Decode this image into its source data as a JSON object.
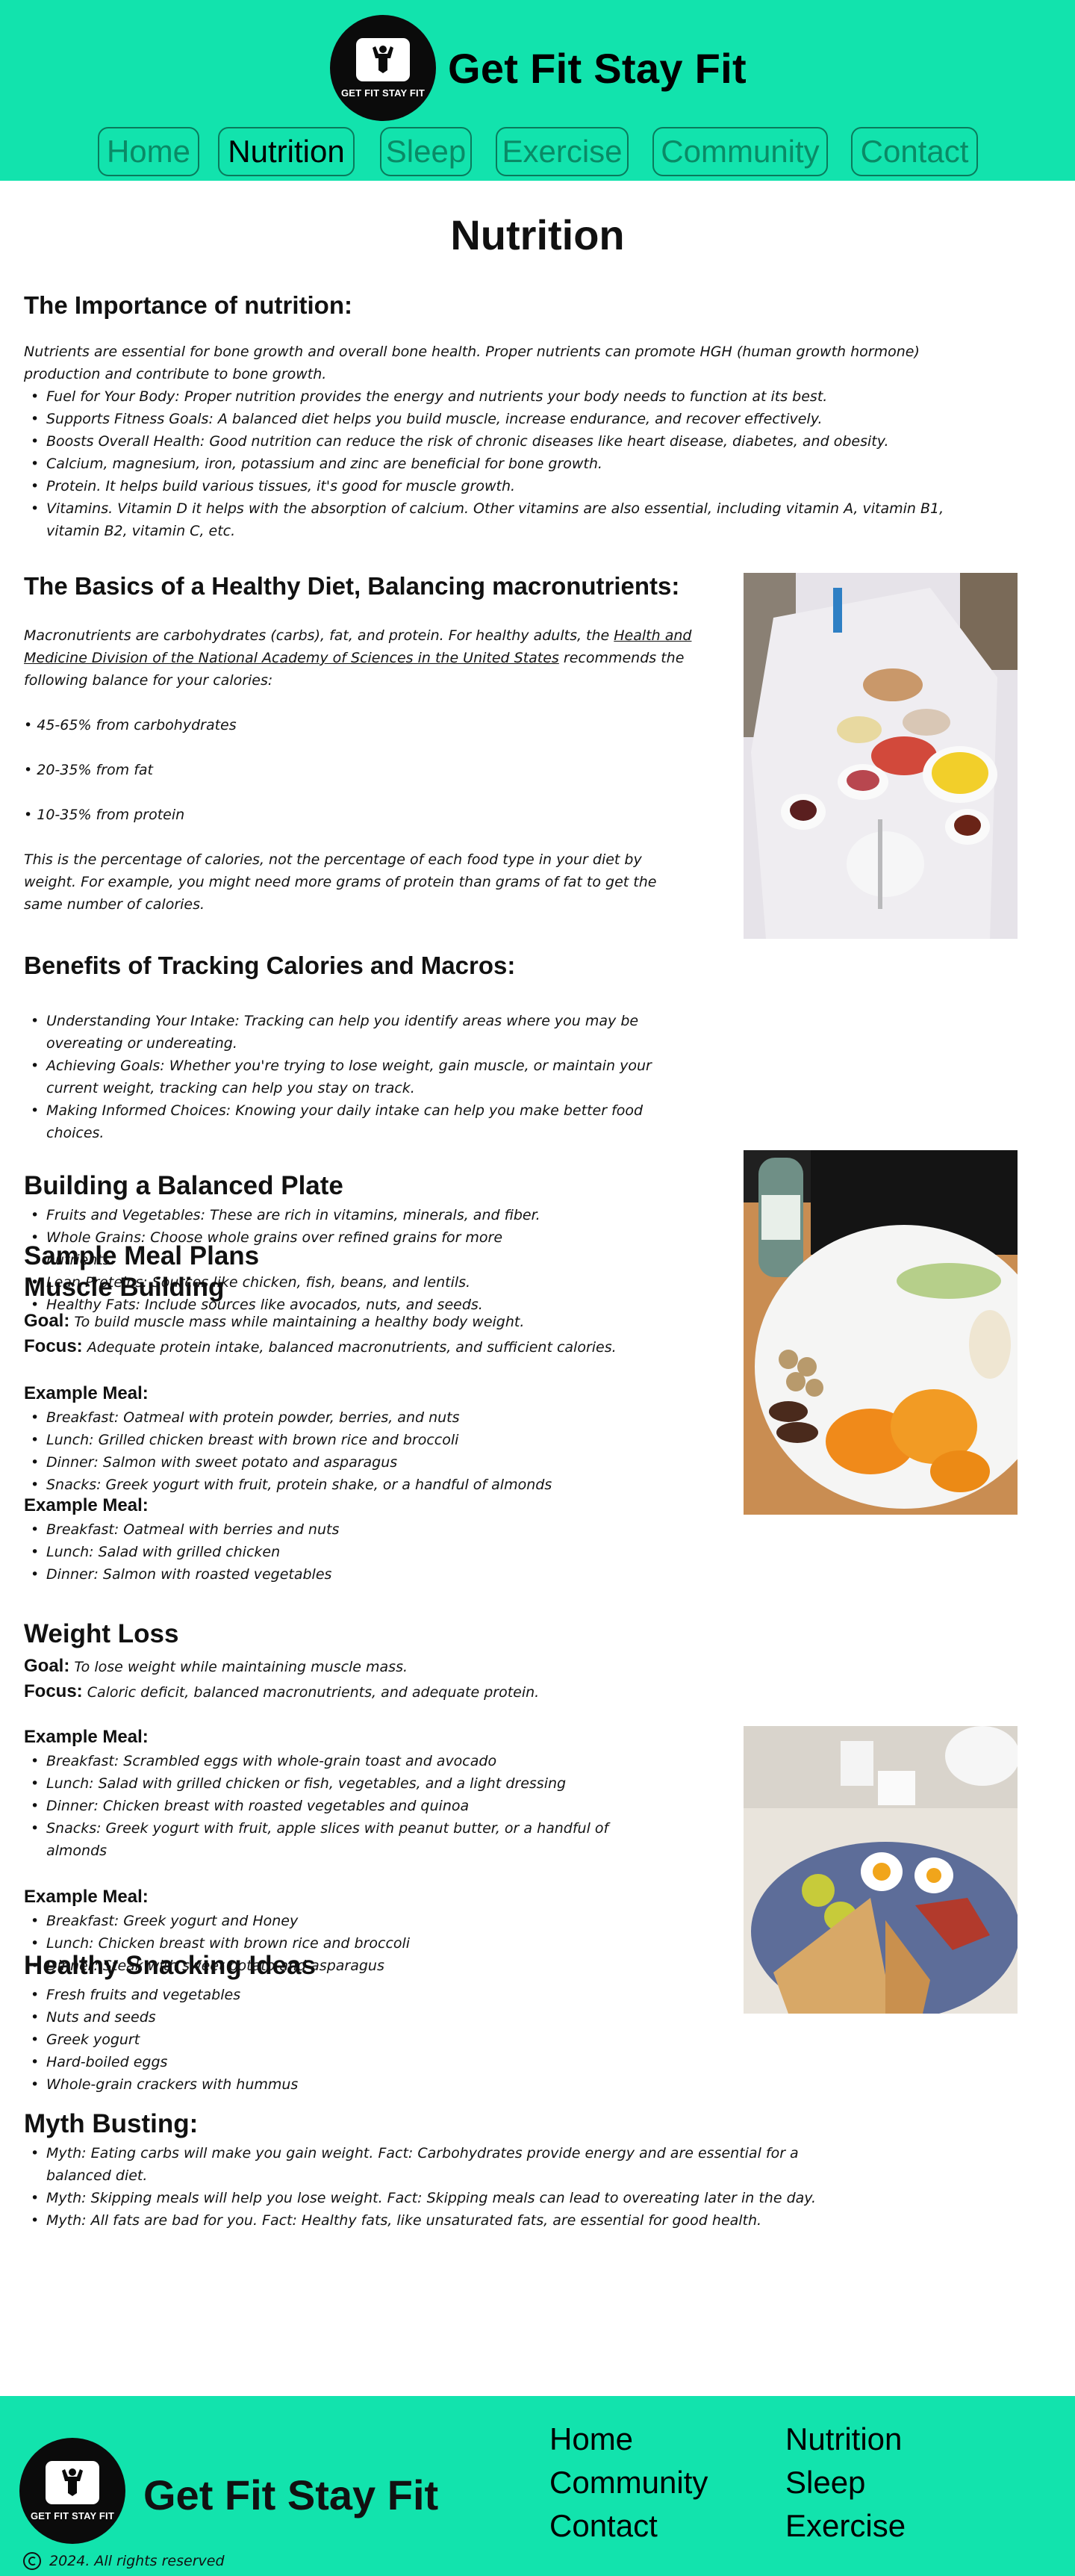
{
  "brand": {
    "name": "Get Fit Stay Fit",
    "logo_text": "GET FIT STAY FIT"
  },
  "nav": [
    {
      "label": "Home",
      "active": false
    },
    {
      "label": "Nutrition",
      "active": true
    },
    {
      "label": "Sleep",
      "active": false
    },
    {
      "label": "Exercise",
      "active": false
    },
    {
      "label": "Community",
      "active": false
    },
    {
      "label": "Contact",
      "active": false
    }
  ],
  "page_title": "Nutrition",
  "importance": {
    "heading": "The Importance of nutrition:",
    "intro": "Nutrients are essential for bone growth and overall bone health. Proper nutrients can promote HGH (human growth hormone) production and contribute to bone growth.",
    "items": [
      "Fuel for Your Body: Proper nutrition provides the energy and nutrients your body needs to function at its best.",
      "Supports Fitness Goals: A balanced diet helps you build muscle, increase endurance, and recover effectively.",
      "Boosts Overall Health: Good nutrition can reduce the risk of chronic diseases like heart disease, diabetes, and obesity.",
      "Calcium, magnesium, iron, potassium and zinc are beneficial for bone growth.",
      " Protein. It helps build various tissues, it's good for muscle growth.",
      "Vitamins. Vitamin D it helps with the absorption of calcium. Other vitamins are also essential, including vitamin A, vitamin B1, vitamin B2, vitamin C, etc."
    ]
  },
  "basics": {
    "heading": "The Basics of a Healthy Diet, Balancing macronutrients:",
    "intro_before_link": "Macronutrients are carbohydrates (carbs), fat, and protein. For healthy adults, the ",
    "link": "Health and Medicine Division of the National Academy of Sciences in the United States",
    "intro_after_link": " recommends the following balance for your calories:",
    "carbs": "• 45-65% from carbohydrates",
    "fat": "• 20-35% from fat",
    "protein": "• 10-35% from protein",
    "note": "This is the percentage of calories, not the percentage of each food type in your diet by weight. For example, you might need more grams of protein than grams of fat to get the same number of calories."
  },
  "benefits": {
    "heading": "Benefits of Tracking Calories and Macros:",
    "items": [
      "Understanding Your Intake: Tracking can help you identify areas where you may be overeating or undereating.",
      "Achieving Goals: Whether you're trying to lose weight, gain muscle, or maintain your current weight, tracking can help you stay on track.",
      "Making Informed Choices: Knowing your daily intake can help you make better food choices."
    ]
  },
  "plate": {
    "heading": "Building a Balanced Plate",
    "items": [
      "Fruits and Vegetables: These are rich in vitamins, minerals, and fiber.",
      "Whole Grains: Choose whole grains over refined grains for more nutrients.",
      "Lean Proteins: Sources like chicken, fish, beans, and lentils.",
      "Healthy Fats: Include sources like avocados, nuts, and seeds."
    ]
  },
  "meal_plans": {
    "heading": "Sample Meal Plans",
    "muscle": {
      "heading": "Muscle Building",
      "goal_label": "Goal:",
      "goal": "To build muscle mass while maintaining a healthy body weight.",
      "focus_label": "Focus:",
      "focus": "Adequate protein intake, balanced macronutrients, and sufficient calories.",
      "example1_label": "Example Meal:",
      "example1": [
        "Breakfast: Oatmeal with protein powder, berries, and nuts",
        "Lunch: Grilled chicken breast with brown rice and broccoli",
        "Dinner: Salmon with sweet potato and asparagus",
        "Snacks: Greek yogurt with fruit, protein shake, or a handful of almonds"
      ],
      "example2_label": "Example Meal:",
      "example2": [
        "Breakfast: Oatmeal with berries and nuts",
        "Lunch: Salad with grilled chicken",
        "Dinner: Salmon with roasted vegetables"
      ]
    },
    "weight_loss": {
      "heading": "Weight Loss",
      "goal_label": "Goal:",
      "goal": "To lose weight while maintaining muscle mass.",
      "focus_label": "Focus:",
      "focus": "Caloric deficit, balanced macronutrients, and adequate protein.",
      "example1_label": "Example Meal:",
      "example1": [
        "Breakfast: Scrambled eggs with whole-grain toast and avocado",
        "Lunch: Salad with grilled chicken or fish, vegetables, and a light dressing",
        "Dinner: Chicken breast with roasted vegetables and quinoa",
        "Snacks: Greek yogurt with fruit, apple slices with peanut butter, or a handful of almonds"
      ],
      "example2_label": "Example Meal:",
      "example2": [
        "Breakfast: Greek yogurt and Honey",
        "Lunch: Chicken breast with brown rice and broccoli",
        "Dinner: Steak with sweet potato and asparagus"
      ]
    }
  },
  "snacking": {
    "heading": "Healthy Snacking Ideas",
    "items": [
      "Fresh fruits and vegetables",
      "Nuts and seeds",
      "Greek yogurt",
      "Hard-boiled eggs",
      "Whole-grain crackers with hummus"
    ]
  },
  "myths": {
    "heading": "Myth Busting:",
    "items": [
      "Myth: Eating carbs will make you gain weight. Fact: Carbohydrates provide energy and are essential for a balanced diet.",
      "Myth: Skipping meals will help you lose weight. Fact: Skipping meals can lead to overeating later in the day.",
      "Myth: All fats are bad for you. Fact: Healthy fats, like unsaturated fats, are essential for good health."
    ]
  },
  "footer": {
    "title": "Get Fit Stay Fit",
    "links": [
      "Home",
      "Nutrition",
      "Community",
      "Sleep",
      "Contact",
      "Exercise"
    ],
    "copyright": "2024. All rights reserved",
    "copyright_icon": "copyright-icon"
  },
  "colors": {
    "accent": "#12e3ad",
    "nav_border": "#0a7a5c",
    "nav_text": "#0a8a66"
  }
}
